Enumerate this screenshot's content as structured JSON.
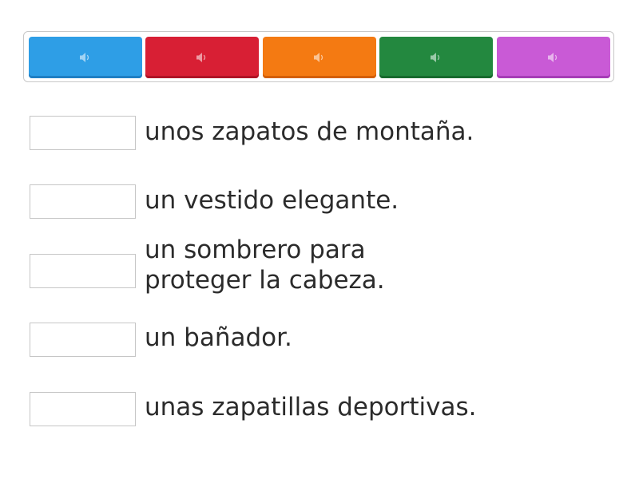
{
  "tiles": [
    {
      "icon": "speaker-icon",
      "color": "#2e9ee6",
      "shade": "#1f7fc4"
    },
    {
      "icon": "speaker-icon",
      "color": "#d81f34",
      "shade": "#b01426"
    },
    {
      "icon": "speaker-icon",
      "color": "#f47a12",
      "shade": "#d35f06"
    },
    {
      "icon": "speaker-icon",
      "color": "#23883f",
      "shade": "#176a2e"
    },
    {
      "icon": "speaker-icon",
      "color": "#c95ad6",
      "shade": "#a63cb6"
    }
  ],
  "items": [
    {
      "text": "unos zapatos de montaña."
    },
    {
      "text": "un vestido elegante."
    },
    {
      "text": "un sombrero para\nproteger la cabeza."
    },
    {
      "text": "un bañador."
    },
    {
      "text": "unas zapatillas deportivas."
    }
  ]
}
